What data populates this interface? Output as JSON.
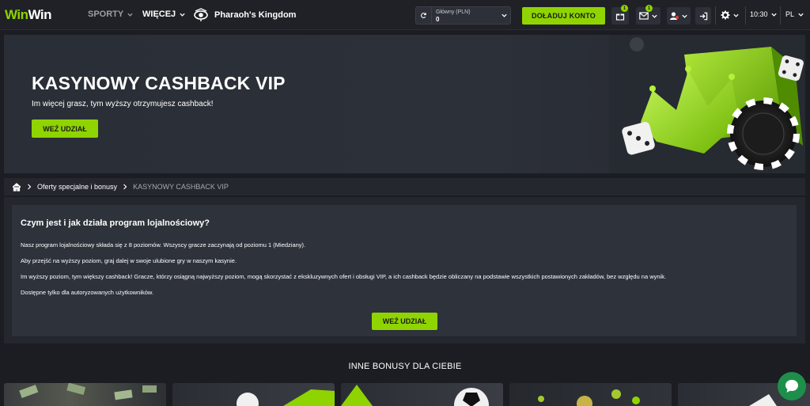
{
  "header": {
    "logo_a": "Win",
    "logo_b": "Win",
    "nav": {
      "sport": "SPORTY",
      "more": "WIĘCEJ",
      "pharaoh": "Pharaoh's Kingdom"
    },
    "balance": {
      "label": "Główny (PLN)",
      "value": "0"
    },
    "topup_label": "DOŁADUJ KONTO",
    "gift_badge": "1",
    "mail_badge": "1",
    "time": "10:30",
    "lang": "PL"
  },
  "banner": {
    "title": "KASYNOWY CASHBACK VIP",
    "subtitle": "Im więcej grasz, tym wyższy otrzymujesz cashback!",
    "button": "WEŹ UDZIAŁ"
  },
  "breadcrumb": {
    "item1": "Oferty specjalne i bonusy",
    "current": "KASYNOWY CASHBACK VIP"
  },
  "info": {
    "title": "Czym jest i jak działa program lojalnościowy?",
    "p1": "Nasz program lojalnościowy składa się z 8 poziomów. Wszyscy gracze zaczynają od poziomu 1 (Miedziany).",
    "p2": "Aby przejść na wyższy poziom, graj dalej w swoje ulubione gry w naszym kasynie.",
    "p3": "Im wyższy poziom, tym większy cashback! Gracze, którzy osiągną najwyższy poziom, mogą skorzystać z ekskluzywnych ofert i obsługi VIP, a ich cashback będzie obliczany na podstawie wszystkich postawionych zakładów, bez względu na wynik.",
    "p4": "Dostępne tylko dla autoryzowanych użytkowników.",
    "button": "WEŹ UDZIAŁ"
  },
  "other_bonuses_title": "INNE BONUSY DLA CIEBIE",
  "colors": {
    "accent": "#8fd400",
    "background": "#1b1d22",
    "panel": "#24272d",
    "card": "#2e323a"
  }
}
